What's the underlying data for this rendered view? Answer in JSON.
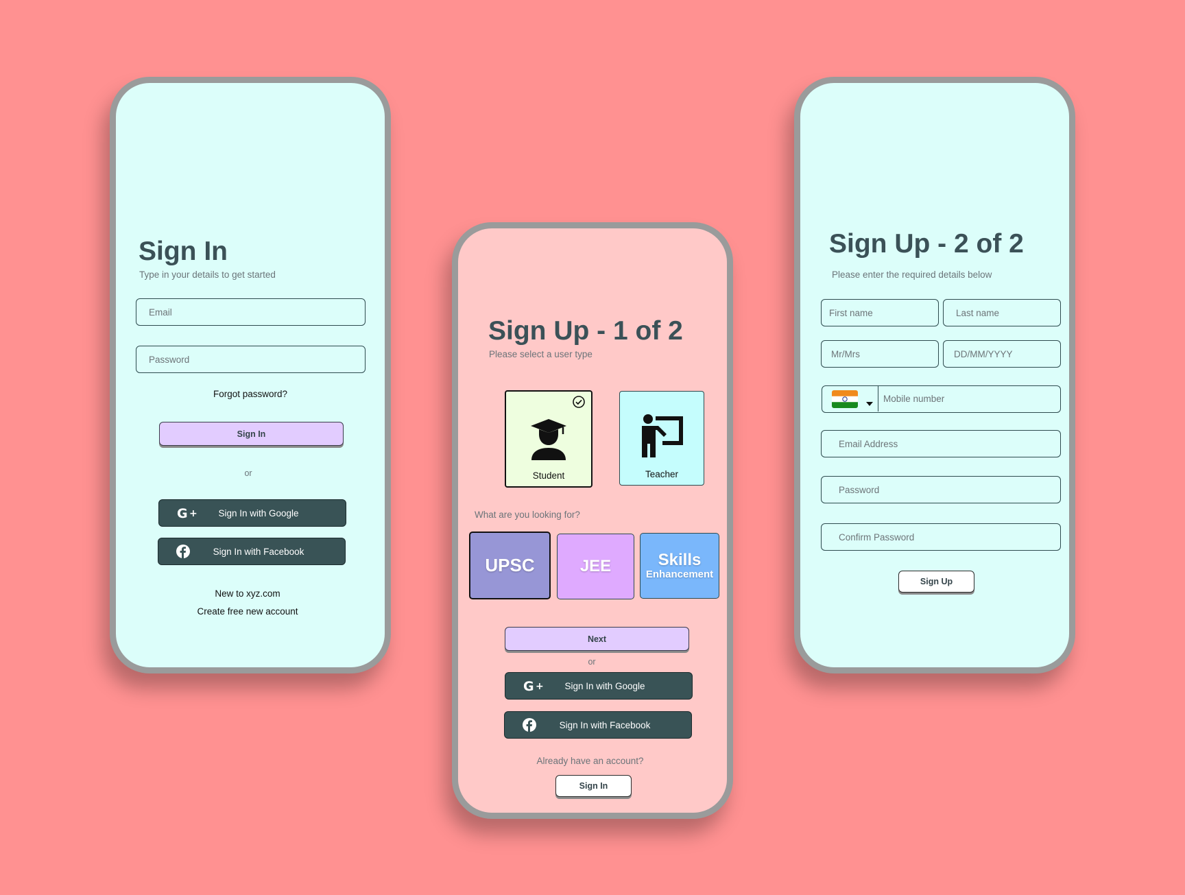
{
  "signin": {
    "title": "Sign In",
    "subtitle": "Type in your details to get started",
    "email_placeholder": "Email",
    "password_placeholder": "Password",
    "forgot": "Forgot password?",
    "signin_label": "Sign In",
    "or": "or",
    "google_label": "Sign In with Google",
    "facebook_label": "Sign In with Facebook",
    "new_text": "New to xyz.com",
    "create_link": "Create free new account"
  },
  "signup1": {
    "title": "Sign Up - 1 of 2",
    "subtitle": "Please select a user type",
    "user_types": [
      {
        "label": "Student",
        "selected": true,
        "icon": "graduate-icon"
      },
      {
        "label": "Teacher",
        "selected": false,
        "icon": "teacher-board-icon"
      }
    ],
    "question": "What are you looking for?",
    "goals": [
      {
        "label": "UPSC",
        "selected": true
      },
      {
        "label": "JEE",
        "selected": false
      },
      {
        "label": "Skills",
        "sub": "Enhancement",
        "selected": false
      }
    ],
    "next_label": "Next",
    "or": "or",
    "google_label": "Sign In with Google",
    "facebook_label": "Sign In with Facebook",
    "already": "Already have an account?",
    "signin_label": "Sign In"
  },
  "signup2": {
    "title": "Sign Up - 2 of 2",
    "subtitle": "Please enter the required details below",
    "first_name_placeholder": "First name",
    "last_name_placeholder": "Last name",
    "title_placeholder": "Mr/Mrs",
    "dob_placeholder": "DD/MM/YYYY",
    "country_flag": "india-flag-icon",
    "mobile_placeholder": "Mobile number",
    "email_placeholder": "Email Address",
    "password_placeholder": "Password",
    "confirm_placeholder": "Confirm Password",
    "signup_label": "Sign Up"
  },
  "colors": {
    "background": "#ff9191",
    "mint_screen": "#dcfefa",
    "pink_screen": "#ffc9c8",
    "dark_button": "#395356",
    "lavender_button": "#e2ccff",
    "upsc_tile": "#9796d6",
    "jee_tile": "#dfaaff",
    "skills_tile": "#7ab7fb",
    "student_card": "#eefedf",
    "teacher_card": "#c5fdfd"
  }
}
